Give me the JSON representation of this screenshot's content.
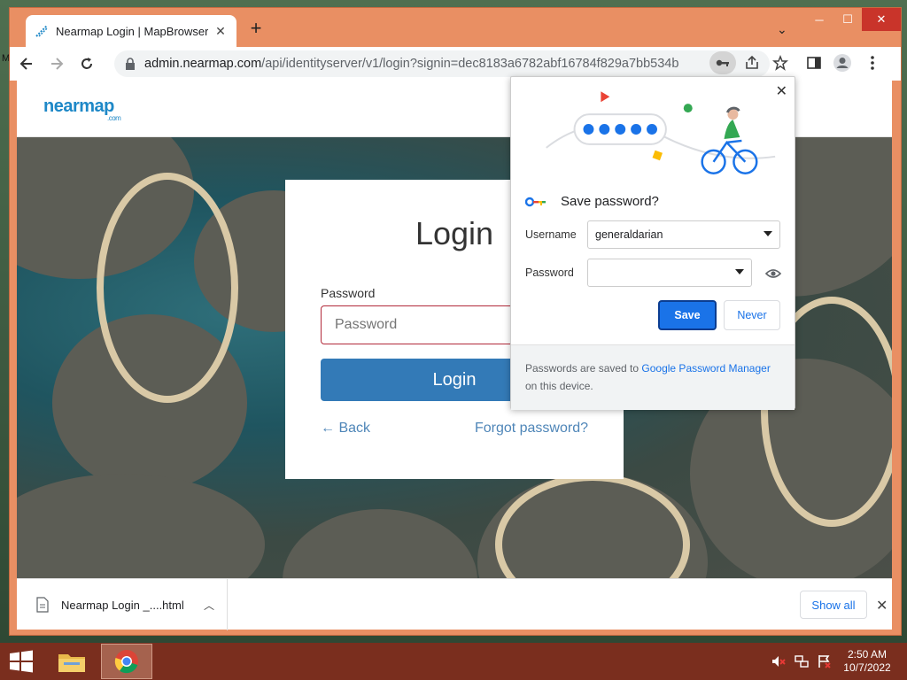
{
  "browser": {
    "tab_title": "Nearmap Login | MapBrowser an",
    "url_host": "admin.nearmap.com",
    "url_path": "/api/identityserver/v1/login?signin=dec8183a6782abf16784f829a7bb534b",
    "new_tab_label": "+"
  },
  "site": {
    "logo_text": "nearmap",
    "logo_sub": ".com"
  },
  "login": {
    "title": "Login",
    "password_label": "Password",
    "password_placeholder": "Password",
    "login_button": "Login",
    "back_link": "← Back",
    "forgot_link": "Forgot password?"
  },
  "password_popup": {
    "title": "Save password?",
    "username_label": "Username",
    "username_value": "generaldarian",
    "password_label": "Password",
    "password_value": "",
    "save_button": "Save",
    "never_button": "Never",
    "footer_prefix": "Passwords are saved to ",
    "footer_link": "Google Password Manager",
    "footer_suffix": " on this device."
  },
  "downloads": {
    "file_name": "Nearmap Login _....html",
    "show_all": "Show all"
  },
  "taskbar": {
    "time": "2:50 AM",
    "date": "10/7/2022"
  },
  "desktop": {
    "edge_letter": "M"
  },
  "colors": {
    "accent_blue": "#1a73e8",
    "login_button": "#337ab7",
    "input_error_border": "#b22a3a",
    "window_frame": "#e98f63",
    "taskbar": "#7a2e1e",
    "nearmap_blue": "#1e88c7"
  },
  "icons": {
    "tab_favicon": "nearmap-favicon-icon",
    "back": "arrow-left-icon",
    "forward": "arrow-right-icon",
    "reload": "reload-icon",
    "lock": "lock-icon",
    "key": "key-icon",
    "share": "share-icon",
    "star": "star-icon",
    "side_panel": "side-panel-icon",
    "profile": "profile-icon",
    "menu": "kebab-menu-icon",
    "eye": "eye-icon",
    "file": "file-icon",
    "start": "windows-start-icon",
    "explorer": "folder-icon",
    "chrome": "chrome-icon"
  }
}
